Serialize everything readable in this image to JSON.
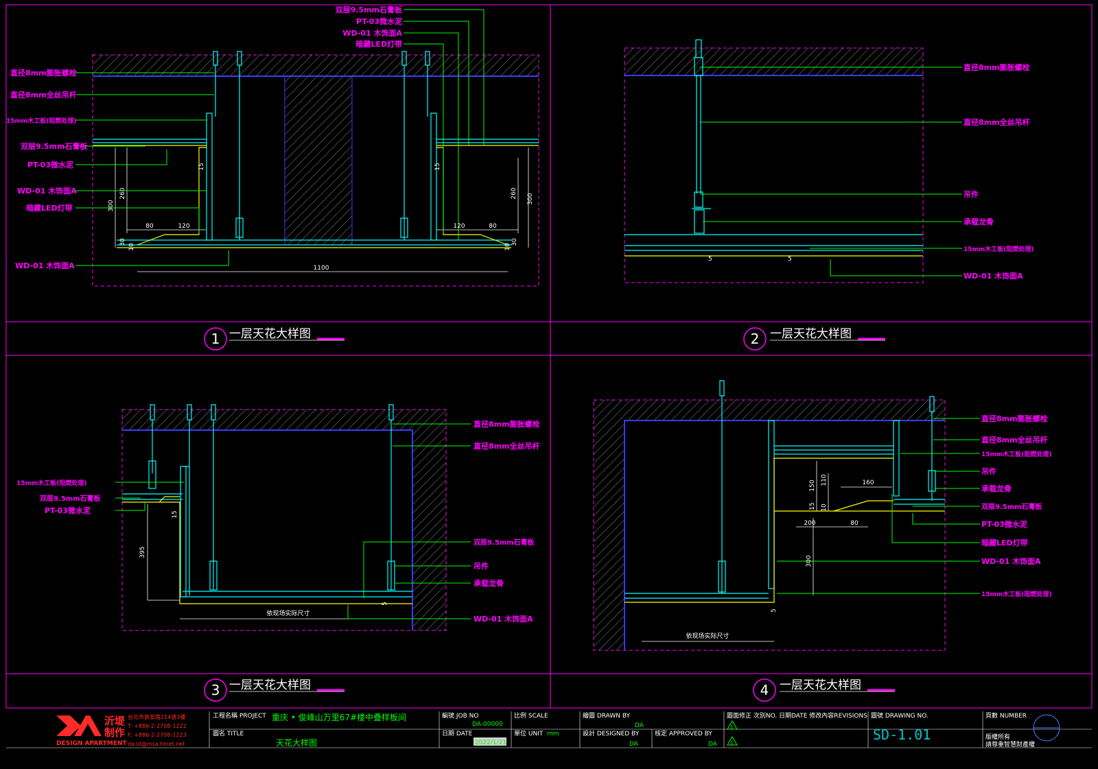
{
  "colors": {
    "background": "#000000",
    "frame": "#ff00ff",
    "label": "#ff00ff",
    "leader": "#00ff00",
    "structure": "#0000ff",
    "hatch": "#888888",
    "member": "#00ffff",
    "finish": "#ffff00",
    "dimension": "#ffffff",
    "logo_red": "#ff2a2a"
  },
  "details": [
    {
      "number": "1",
      "title": "一层天花大样图",
      "labels": {
        "bolt": "直径8mm膨胀螺栓",
        "rod": "直径8mm全丝吊杆",
        "board15": "15mm木工板(阻燃处理)",
        "gypsum": "双层9.5mm石膏板",
        "pt03": "PT-03微水泥",
        "wd01": "WD-01  木饰面A",
        "led": "暗藏LED灯带",
        "wd01_bottom": "WD-01  木饰面A"
      },
      "top_labels": {
        "gypsum": "双层9.5mm石膏板",
        "pt03": "PT-03微水泥",
        "wd01": "WD-01  木饰面A",
        "led": "暗藏LED灯带"
      },
      "dims": {
        "d300": "300",
        "d260": "260",
        "d15": "15",
        "d80": "80",
        "d120": "120",
        "d30": "30",
        "d10": "10",
        "d1100": "1100"
      }
    },
    {
      "number": "2",
      "title": "一层天花大样图",
      "labels": {
        "bolt": "直径8mm膨胀螺栓",
        "rod": "直径8mm全丝吊杆",
        "hanger": "吊件",
        "keel": "承载龙骨",
        "board15": "15mm木工板(阻燃处理)",
        "wd01": "WD-01  木饰面A"
      },
      "dims": {
        "d5a": "5",
        "d5b": "5"
      }
    },
    {
      "number": "3",
      "title": "一层天花大样图",
      "labels": {
        "bolt": "直径8mm膨胀螺栓",
        "rod": "直径8mm全丝吊杆",
        "board15": "15mm木工板(阻燃处理)",
        "gypsum": "双层9.5mm石膏板",
        "pt03": "PT-03微水泥",
        "gypsum2": "双层9.5mm石膏板",
        "hanger": "吊件",
        "keel": "承载龙骨",
        "wd01": "WD-01  木饰面A"
      },
      "dims": {
        "d15": "15",
        "d395": "395",
        "site": "依现场实际尺寸",
        "d5": "5"
      }
    },
    {
      "number": "4",
      "title": "一层天花大样图",
      "labels": {
        "bolt": "直径8mm膨胀螺栓",
        "rod": "直径8mm全丝吊杆",
        "board15": "15mm木工板(阻燃处理)",
        "hanger": "吊件",
        "keel": "承载龙骨",
        "gypsum": "双层9.5mm石膏板",
        "pt03": "PT-03微水泥",
        "led": "暗藏LED灯带",
        "wd01": "WD-01  木饰面A",
        "board15b": "15mm木工板(阻燃处理)"
      },
      "dims": {
        "d150": "150",
        "d110": "110",
        "d160": "160",
        "d15": "15",
        "d10": "10",
        "d200": "200",
        "d80": "80",
        "d300": "300",
        "d5": "5",
        "site": "依现场实际尺寸"
      }
    }
  ],
  "title_block": {
    "logo_cn_top": "沂堤",
    "logo_cn_bottom": "制作",
    "logo_en": "DESIGN APARTMENT",
    "address": "台北市敦安路214號3樓",
    "tel": "T: +886-2-2708-1222",
    "fax": "F: +886-2-2708-1223",
    "email": "da.id@msa.hinet.net",
    "project_label": "工程名稱 PROJECT",
    "project_value": "重庆 • 俊峰山万里67#楼中叠样板间",
    "title_label": "圖名 TITLE",
    "title_value": "天花大样图",
    "job_label": "編號 JOB NO",
    "job_value": "DA-00000",
    "date_label": "日期 DATE",
    "date_value": "2022/1/21",
    "scale_label": "比例 SCALE",
    "unit_label": "單位 UNIT",
    "unit_value": "mm",
    "drawn_label": "繪圖 DRAWN BY",
    "drawn_value": "DA",
    "designed_label": "設計 DESIGNED BY",
    "designed_value": "DA",
    "approved_label": "核定 APPROVED BY",
    "approved_value": "DA",
    "revisions_label": "圖面修正 次別NO. 日期DATE 修改內容REVISIONS",
    "rev1": "1",
    "rev2": "2",
    "drawing_label": "圖號 DRAWING NO.",
    "drawing_value": "SD-1.01",
    "number_label": "頁數 NUMBER",
    "copyright_line1": "版權所有",
    "copyright_line2": "請尊重智慧財產權"
  }
}
